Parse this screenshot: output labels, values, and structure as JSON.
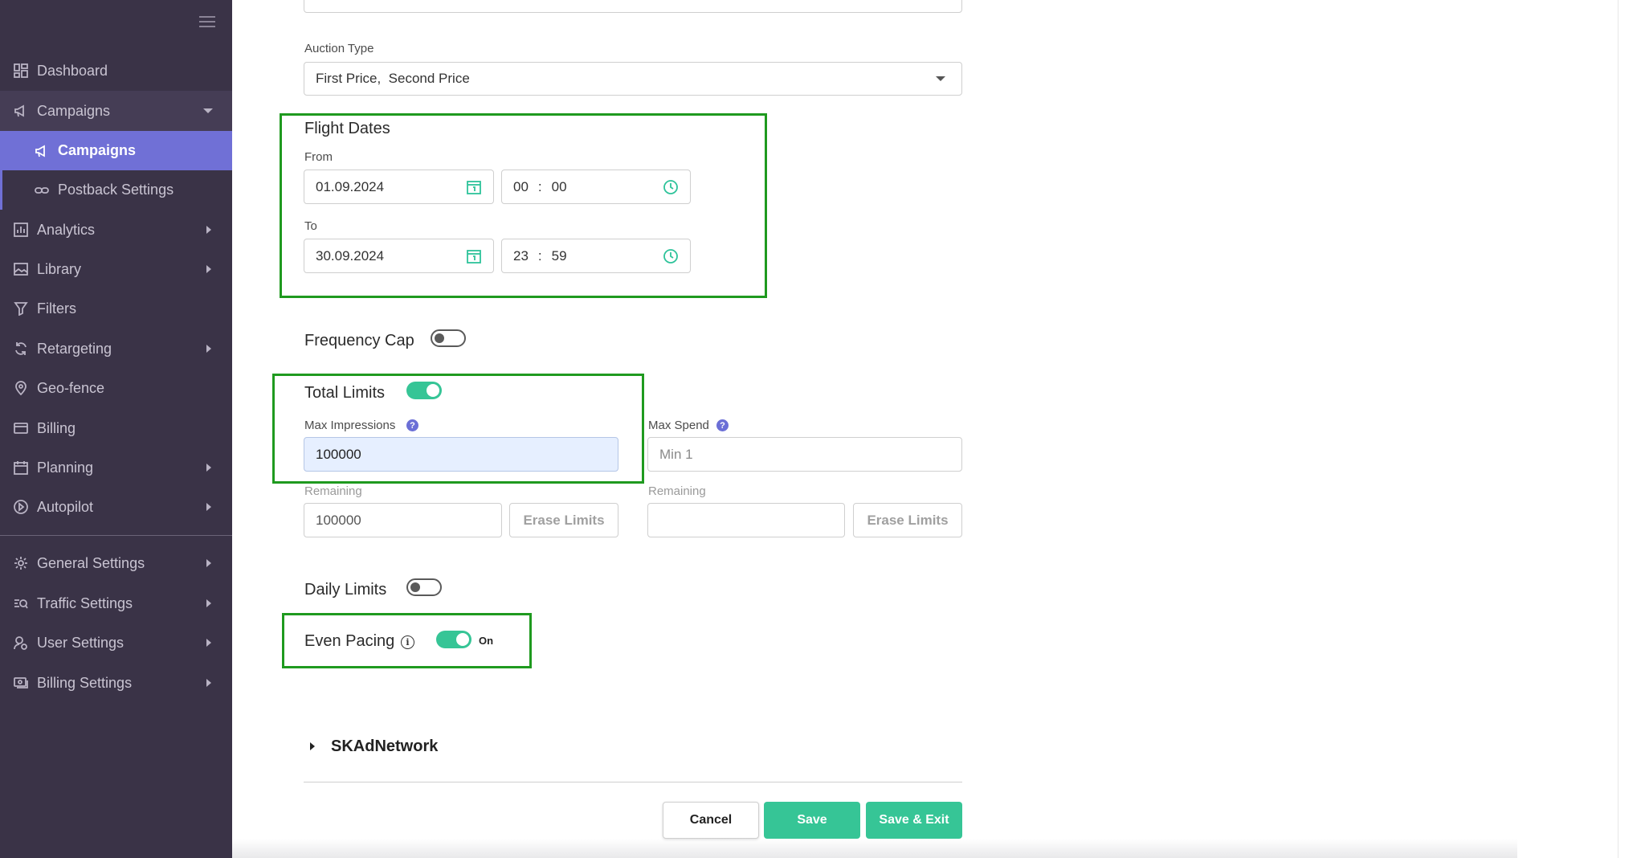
{
  "sidebar": {
    "items": [
      {
        "label": "Dashboard",
        "icon": "dashboard-icon"
      },
      {
        "label": "Campaigns",
        "icon": "megaphone-icon"
      },
      {
        "label": "Campaigns",
        "icon": "megaphone-icon"
      },
      {
        "label": "Postback Settings",
        "icon": "link-icon"
      },
      {
        "label": "Analytics",
        "icon": "bar-chart-icon"
      },
      {
        "label": "Library",
        "icon": "image-icon"
      },
      {
        "label": "Filters",
        "icon": "filter-icon"
      },
      {
        "label": "Retargeting",
        "icon": "refresh-icon"
      },
      {
        "label": "Geo-fence",
        "icon": "map-pin-icon"
      },
      {
        "label": "Billing",
        "icon": "credit-card-icon"
      },
      {
        "label": "Planning",
        "icon": "calendar-icon"
      },
      {
        "label": "Autopilot",
        "icon": "play-circle-icon"
      },
      {
        "label": "General Settings",
        "icon": "gear-icon"
      },
      {
        "label": "Traffic Settings",
        "icon": "traffic-search-icon"
      },
      {
        "label": "User Settings",
        "icon": "user-settings-icon"
      },
      {
        "label": "Billing Settings",
        "icon": "billing-settings-icon"
      }
    ]
  },
  "form": {
    "auction_type": {
      "label": "Auction Type",
      "value": "First Price,  Second Price"
    },
    "flight_dates": {
      "title": "Flight Dates",
      "from_label": "From",
      "from_date": "01.09.2024",
      "from_hour": "00",
      "from_minute": "00",
      "to_label": "To",
      "to_date": "30.09.2024",
      "to_hour": "23",
      "to_minute": "59",
      "time_separator": ":"
    },
    "frequency_cap": {
      "label": "Frequency Cap",
      "enabled": false
    },
    "total_limits": {
      "label": "Total Limits",
      "enabled": true,
      "max_impressions_label": "Max Impressions",
      "max_impressions_value": "100000",
      "max_spend_label": "Max Spend",
      "max_spend_placeholder": "Min 1",
      "remaining_label": "Remaining",
      "remaining_impressions": "100000",
      "remaining_spend": "",
      "erase_label": "Erase Limits",
      "help_glyph": "?"
    },
    "daily_limits": {
      "label": "Daily Limits",
      "enabled": false
    },
    "even_pacing": {
      "label": "Even Pacing",
      "enabled": true,
      "state_text": "On",
      "info_glyph": "i"
    },
    "skadnetwork": {
      "label": "SKAdNetwork"
    }
  },
  "actions": {
    "cancel": "Cancel",
    "save": "Save",
    "save_exit": "Save & Exit"
  },
  "colors": {
    "sidebar_bg": "#3a3347",
    "active_item": "#7070d6",
    "accent_green": "#36c596",
    "highlight_border": "#1f9a1f"
  }
}
